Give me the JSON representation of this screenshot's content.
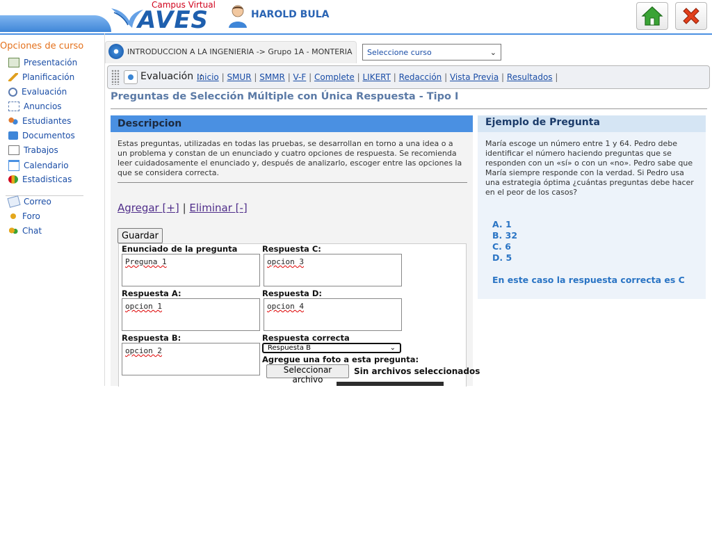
{
  "header": {
    "logo_subtitle": "Campus Virtual",
    "logo_title": "AVES",
    "user_name": "HAROLD BULA"
  },
  "sidebar": {
    "title": "Opciones de curso",
    "items": [
      {
        "label": "Presentación",
        "icon": "presentation-icon"
      },
      {
        "label": "Planificación",
        "icon": "pencil-icon"
      },
      {
        "label": "Evaluación",
        "icon": "magnifier-icon"
      },
      {
        "label": "Anuncios",
        "icon": "announcement-icon"
      },
      {
        "label": "Estudiantes",
        "icon": "students-icon"
      },
      {
        "label": "Documentos",
        "icon": "documents-icon"
      },
      {
        "label": "Trabajos",
        "icon": "assignments-icon"
      },
      {
        "label": "Calendario",
        "icon": "calendar-icon"
      },
      {
        "label": "Estadisticas",
        "icon": "stats-icon"
      }
    ],
    "items2": [
      {
        "label": "Correo",
        "icon": "mail-icon"
      },
      {
        "label": "Foro",
        "icon": "forum-icon"
      },
      {
        "label": "Chat",
        "icon": "chat-icon"
      }
    ]
  },
  "course": {
    "title": "INTRODUCCION A LA INGENIERIA -> Grupo 1A - MONTERIA",
    "select_value": "Seleccione curso"
  },
  "eval_bar": {
    "label": "Evaluación ::",
    "links": [
      "Inicio",
      "SMUR",
      "SMMR",
      "V-F",
      "Complete",
      "LIKERT",
      "Redacción",
      "Vista Previa",
      "Resultados"
    ]
  },
  "main": {
    "heading": "Preguntas de Selección Múltiple con Única Respuesta - Tipo I"
  },
  "description": {
    "title": "Descripcion",
    "text": "Estas preguntas, utilizadas en todas las pruebas, se desarrollan en torno a una idea o a un problema y constan de un enunciado y cuatro opciones de respuesta. Se recomienda leer cuidadosamente el enunciado y, después de analizarlo, escoger entre las opciones la que se considera correcta.",
    "add_link": "Agregar [+]",
    "separator": "|",
    "remove_link": "Eliminar [-]",
    "save_label": "Guardar"
  },
  "form": {
    "q_label": "Enunciado de la pregunta",
    "q_value": "Preguna 1",
    "a_label": "Respuesta A:",
    "a_value": "opcion 1",
    "b_label": "Respuesta B:",
    "b_value": "opcion 2",
    "c_label": "Respuesta C:",
    "c_value": "opcion 3",
    "d_label": "Respuesta D:",
    "d_value": "opcion 4",
    "correct_label": "Respuesta correcta",
    "correct_value": "Respuesta B",
    "photo_label": "Agregue una foto a esta pregunta:",
    "file_button": "Seleccionar archivo",
    "file_status": "Sin archivos seleccionados"
  },
  "example": {
    "title": "Ejemplo de Pregunta",
    "text": "María escoge un número entre 1 y 64. Pedro debe identificar el número haciendo preguntas que se responden con un «sí» o con un «no». Pedro sabe que María siempre responde con la verdad. Si Pedro usa una estrategia óptima ¿cuántas preguntas debe hacer en el peor de los casos?",
    "options": [
      "A. 1",
      "B. 32",
      "C. 6",
      "D. 5"
    ],
    "answer": "En este caso la respuesta correcta es C"
  },
  "colors": {
    "accent": "#4a90e2",
    "link": "#1a4da6",
    "sidebar_title": "#e4711c"
  }
}
